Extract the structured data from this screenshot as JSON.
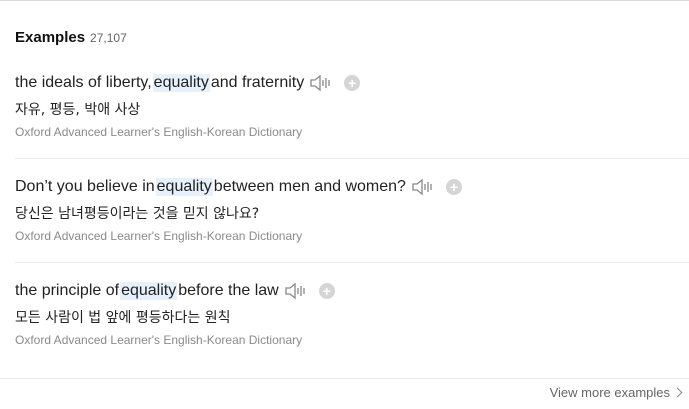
{
  "header": {
    "title": "Examples",
    "count": "27,107"
  },
  "examples": [
    {
      "before": "the ideals of liberty, ",
      "highlight": "equality",
      "after": " and fraternity",
      "translation": "자유, 평등, 박애 사상",
      "source": "Oxford Advanced Learner's English-Korean Dictionary"
    },
    {
      "before": "Don’t you believe in ",
      "highlight": "equality",
      "after": " between men and women?",
      "translation": "당신은 남녀평등이라는 것을 믿지 않나요?",
      "source": "Oxford Advanced Learner's English-Korean Dictionary"
    },
    {
      "before": "the principle of ",
      "highlight": "equality",
      "after": " before the law",
      "translation": "모든 사람이 법 앞에 평등하다는 원칙",
      "source": "Oxford Advanced Learner's English-Korean Dictionary"
    }
  ],
  "icons": {
    "speaker": "speaker-icon",
    "add": "plus-icon",
    "chevron": "chevron-right-icon"
  },
  "footer": {
    "view_more": "View more examples"
  },
  "colors": {
    "highlight_bg": "#e6f1fb",
    "source_text": "#8a8a8a",
    "icon_gray": "#d5d5d5"
  }
}
